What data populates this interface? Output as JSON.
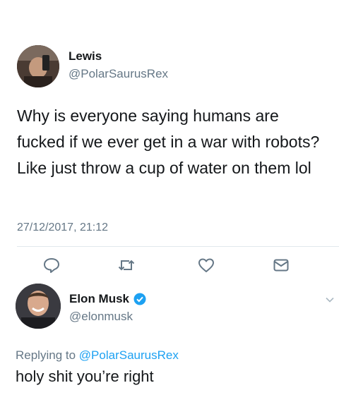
{
  "tweet": {
    "user": {
      "name": "Lewis",
      "handle": "@PolarSaurusRex"
    },
    "text": "Why is everyone saying humans are fucked if we ever get in a war with robots? Like just throw a cup of water on them lol",
    "timestamp": "27/12/2017, 21:12",
    "actions": [
      {
        "name": "reply",
        "icon": "reply-icon"
      },
      {
        "name": "retweet",
        "icon": "retweet-icon"
      },
      {
        "name": "like",
        "icon": "heart-icon"
      },
      {
        "name": "direct-message",
        "icon": "envelope-icon"
      }
    ]
  },
  "reply": {
    "user": {
      "name": "Elon Musk",
      "handle": "@elonmusk",
      "verified": true
    },
    "replying_prefix": "Replying to ",
    "replying_to": "@PolarSaurusRex",
    "text": "holy shit you’re right"
  },
  "colors": {
    "text": "#14171a",
    "secondary": "#657786",
    "accent": "#1da1f2",
    "divider": "#e1e8ed"
  }
}
